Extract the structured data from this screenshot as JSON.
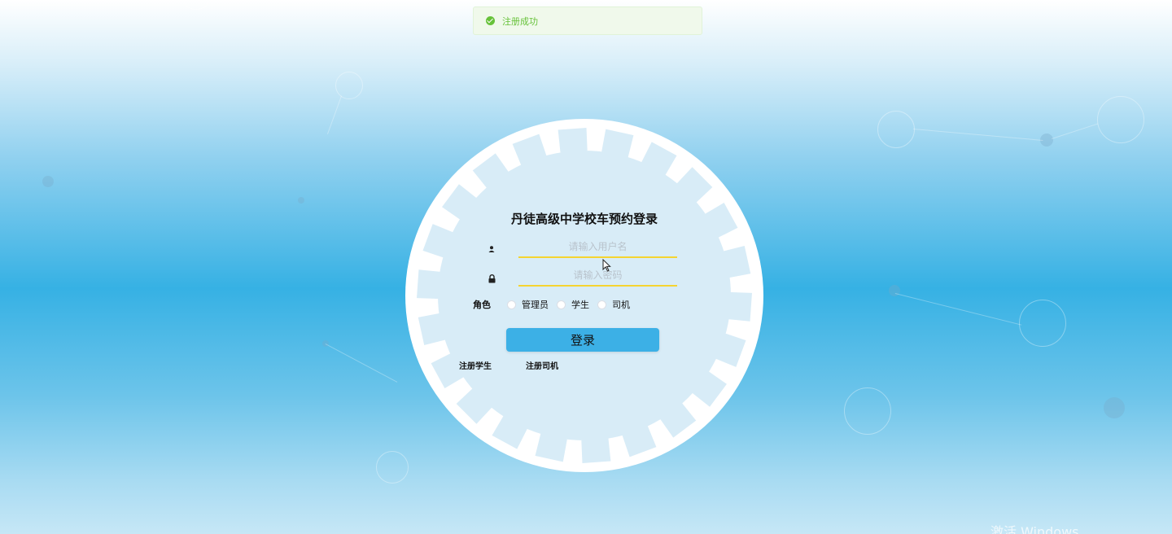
{
  "toast": {
    "message": "注册成功",
    "icon": "check-circle-icon",
    "color": "#67c23a"
  },
  "login": {
    "title": "丹徒高级中学校车预约登录",
    "username_placeholder": "请输入用户名",
    "password_placeholder": "请输入密码",
    "username_value": "",
    "password_value": "",
    "role_label": "角色",
    "roles": [
      "管理员",
      "学生",
      "司机"
    ],
    "login_button": "登录",
    "register_student": "注册学生",
    "register_driver": "注册司机",
    "accent_color": "#3cb0e6",
    "underline_color": "#f5d431"
  },
  "watermark": "激活 Windows"
}
